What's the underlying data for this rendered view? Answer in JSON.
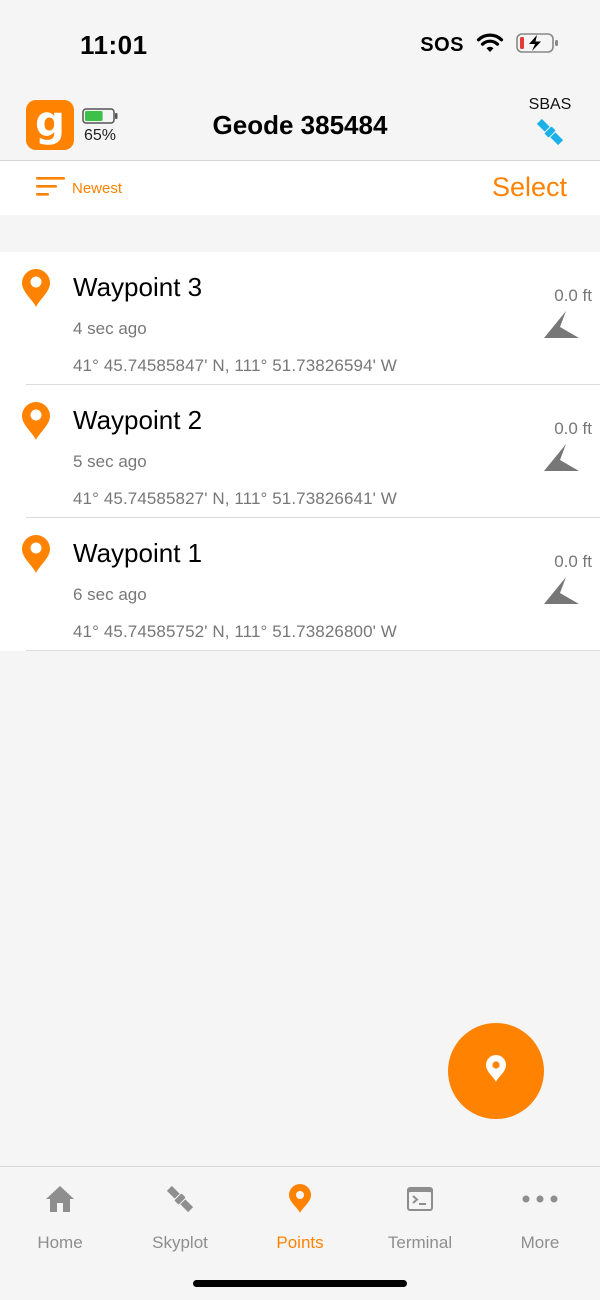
{
  "status_bar": {
    "time": "11:01",
    "sos": "SOS"
  },
  "header": {
    "logo_letter": "g",
    "battery_percent": "65%",
    "battery_level": 0.65,
    "device_name": "Geode 385484",
    "sbas_label": "SBAS"
  },
  "toolbar": {
    "sort_label": "Newest",
    "select_label": "Select"
  },
  "waypoints": [
    {
      "name": "Waypoint 3",
      "time": "4 sec ago",
      "coords": "41° 45.74585847' N, 111° 51.73826594' W",
      "distance": "0.0 ft"
    },
    {
      "name": "Waypoint 2",
      "time": "5 sec ago",
      "coords": "41° 45.74585827' N, 111° 51.73826641' W",
      "distance": "0.0 ft"
    },
    {
      "name": "Waypoint 1",
      "time": "6 sec ago",
      "coords": "41° 45.74585752' N, 111° 51.73826800' W",
      "distance": "0.0 ft"
    }
  ],
  "tabs": [
    {
      "label": "Home",
      "icon": "home-icon"
    },
    {
      "label": "Skyplot",
      "icon": "satellite-icon"
    },
    {
      "label": "Points",
      "icon": "pin-icon",
      "active": true
    },
    {
      "label": "Terminal",
      "icon": "terminal-icon"
    },
    {
      "label": "More",
      "icon": "more-icon"
    }
  ],
  "colors": {
    "accent": "#ff8200",
    "sbas_icon": "#1ab0e8",
    "battery": "#3cc04a"
  }
}
